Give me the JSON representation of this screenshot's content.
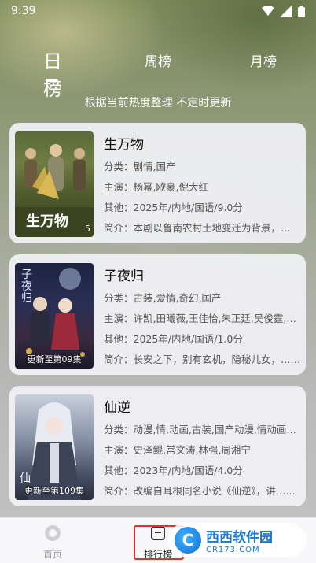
{
  "status_bar": {
    "time": "9:39",
    "icons": [
      "wifi-icon",
      "signal-icon",
      "battery-icon"
    ]
  },
  "tabs": [
    {
      "label": "日榜",
      "active": true
    },
    {
      "label": "周榜",
      "active": false
    },
    {
      "label": "月榜",
      "active": false
    }
  ],
  "subtitle": "根据当前热度整理 不定时更新",
  "items": [
    {
      "title": "生万物",
      "category": "分类：剧情,国产",
      "cast": "主演：杨幂,欧豪,倪大红",
      "other": "其他：2025年/内地/国语/9.0分",
      "intro": "简介：本剧以鲁南农村土地变迁为背景，讲述……",
      "poster_badge": "",
      "poster_num": "5",
      "poster_title": "生万物"
    },
    {
      "title": "子夜归",
      "category": "分类：古装,爱情,奇幻,国产",
      "cast": "主演：许凯,田曦薇,王佳怡,朱正廷,吴俊霆,……",
      "other": "其他：2025年/内地/国语/1.0分",
      "intro": "简介：长安之下，别有玄机，隐秘儿女，……",
      "poster_badge": "更新至第09集",
      "poster_num": "",
      "poster_title": "子夜归"
    },
    {
      "title": "仙逆",
      "category": "分类：动漫,情,动画,古装,国产动漫,情动画……",
      "cast": "主演：史泽鲲,常文涛,林强,周湘宁",
      "other": "其他：2023年/内地/国语/4.0分",
      "intro": "简介：改编自耳根同名小说《仙逆》，讲……",
      "poster_badge": "更新至第109集",
      "poster_num": "",
      "poster_title": "仙"
    }
  ],
  "bottom_nav": [
    {
      "label": "首页",
      "icon": "home-icon"
    },
    {
      "label": "排行榜",
      "icon": "ranking-icon"
    }
  ],
  "watermark": {
    "logo": "C",
    "main": "西西软件园",
    "sub": "CR173.COM"
  }
}
